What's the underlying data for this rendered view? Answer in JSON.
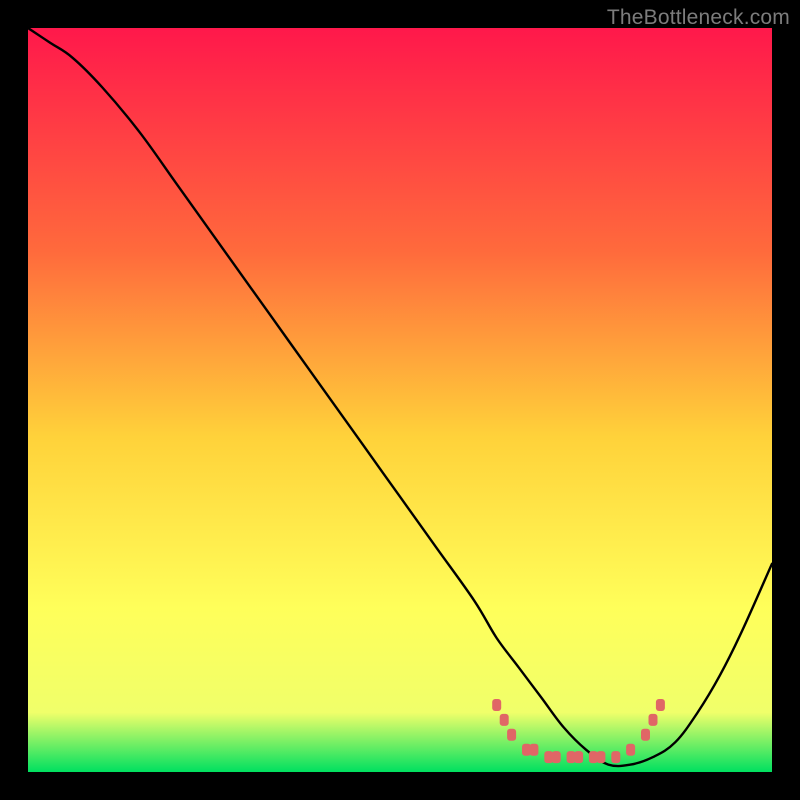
{
  "watermark": "TheBottleneck.com",
  "colors": {
    "page_bg": "#000000",
    "curve": "#000000",
    "marker": "#e06666",
    "grad_top": "#ff184b",
    "grad_mid1": "#ff6a3c",
    "grad_mid2": "#ffd23a",
    "grad_mid3": "#ffff5a",
    "grad_mid4": "#f0ff6a",
    "grad_bottom": "#00e060"
  },
  "chart_data": {
    "type": "line",
    "title": "",
    "xlabel": "",
    "ylabel": "",
    "xlim": [
      0,
      100
    ],
    "ylim": [
      0,
      100
    ],
    "series": [
      {
        "name": "bottleneck-curve",
        "x": [
          0,
          3,
          6,
          10,
          15,
          20,
          25,
          30,
          35,
          40,
          45,
          50,
          55,
          60,
          63,
          66,
          69,
          72,
          75,
          78,
          81,
          84,
          87,
          90,
          93,
          96,
          100
        ],
        "y": [
          100,
          98,
          96,
          92,
          86,
          79,
          72,
          65,
          58,
          51,
          44,
          37,
          30,
          23,
          18,
          14,
          10,
          6,
          3,
          1,
          1,
          2,
          4,
          8,
          13,
          19,
          28
        ]
      }
    ],
    "flat_region": {
      "x_start": 63,
      "x_end": 84,
      "y_approx": 3
    },
    "markers": [
      {
        "x": 63,
        "y": 9
      },
      {
        "x": 64,
        "y": 7
      },
      {
        "x": 65,
        "y": 5
      },
      {
        "x": 67,
        "y": 3
      },
      {
        "x": 68,
        "y": 3
      },
      {
        "x": 70,
        "y": 2
      },
      {
        "x": 71,
        "y": 2
      },
      {
        "x": 73,
        "y": 2
      },
      {
        "x": 74,
        "y": 2
      },
      {
        "x": 76,
        "y": 2
      },
      {
        "x": 77,
        "y": 2
      },
      {
        "x": 79,
        "y": 2
      },
      {
        "x": 81,
        "y": 3
      },
      {
        "x": 83,
        "y": 5
      },
      {
        "x": 84,
        "y": 7
      },
      {
        "x": 85,
        "y": 9
      }
    ]
  }
}
